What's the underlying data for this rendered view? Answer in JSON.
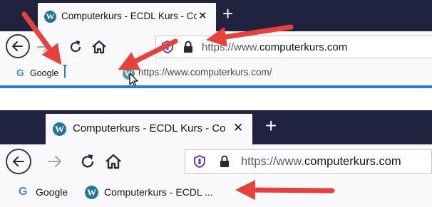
{
  "screenshot_before": {
    "tab": {
      "title": "Computerkurs - ECDL Kurs - Co",
      "close": "✕"
    },
    "new_tab": "+",
    "url": {
      "prefix": "https://www.",
      "host": "computerkurs.com"
    },
    "bookmarks": {
      "google_label": "Google",
      "drag_url": "https://www.computerkurs.com/"
    }
  },
  "screenshot_after": {
    "tab": {
      "title": "Computerkurs - ECDL Kurs - Co",
      "close": "✕"
    },
    "new_tab": "+",
    "url": {
      "prefix": "https://www.",
      "host": "computerkurs.com"
    },
    "bookmarks": {
      "google_label": "Google",
      "new_bookmark_label": "Computerkurs - ECDL ..."
    }
  },
  "icons": {
    "back": "arrow-left-icon",
    "forward": "arrow-right-icon",
    "reload": "reload-icon",
    "home": "home-icon",
    "shield": "shield-icon",
    "lock": "lock-icon",
    "wordpress": "wordpress-icon",
    "google": "google-g-icon",
    "cursor": "mouse-cursor-icon",
    "annotation_arrow": "red-arrow-icon"
  },
  "colors": {
    "tabbar": "#202340",
    "toolbar": "#f9f9fb",
    "arrow": "#e8413a",
    "accent": "#2a7bd4",
    "wordpress": "#21759b",
    "shield": "#5b3fd1"
  }
}
